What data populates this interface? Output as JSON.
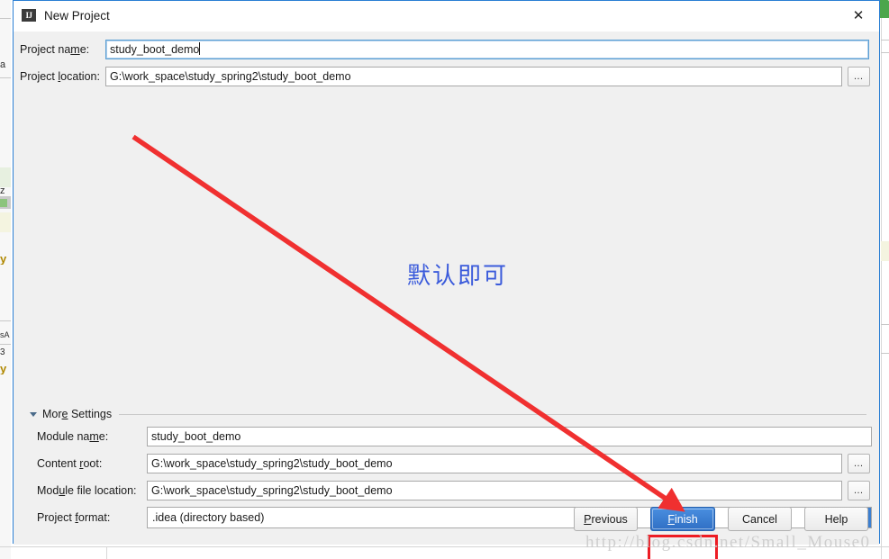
{
  "window": {
    "title": "New Project",
    "icon": "intellij-idea-icon",
    "icon_text": "IJ",
    "close_label": "✕"
  },
  "top_fields": [
    {
      "label_before": "Project na",
      "label_mnemonic": "m",
      "label_after": "e:",
      "value": "study_boot_demo",
      "focused": true,
      "has_browse": false
    },
    {
      "label_before": "Project ",
      "label_mnemonic": "l",
      "label_after": "ocation:",
      "value": "G:\\work_space\\study_spring2\\study_boot_demo",
      "focused": false,
      "has_browse": true
    }
  ],
  "more_settings": {
    "label_before": "Mor",
    "label_mnemonic": "e",
    "label_after": " Settings",
    "expanded": true
  },
  "settings_fields": [
    {
      "label_before": "Module na",
      "label_mnemonic": "m",
      "label_after": "e:",
      "value": "study_boot_demo",
      "has_browse": false
    },
    {
      "label_before": "Content ",
      "label_mnemonic": "r",
      "label_after": "oot:",
      "value": "G:\\work_space\\study_spring2\\study_boot_demo",
      "has_browse": true
    },
    {
      "label_before": "Mod",
      "label_mnemonic": "u",
      "label_after": "le file location:",
      "value": "G:\\work_space\\study_spring2\\study_boot_demo",
      "has_browse": true
    }
  ],
  "project_format": {
    "label_before": "Project ",
    "label_mnemonic": "f",
    "label_after": "ormat:",
    "value": ".idea (directory based)",
    "arrow_icon": "chevron-down-icon"
  },
  "buttons": {
    "previous": {
      "before": "",
      "mnemonic": "P",
      "after": "revious"
    },
    "finish": {
      "before": "",
      "mnemonic": "F",
      "after": "inish",
      "primary": true,
      "highlighted": true
    },
    "cancel": {
      "before": "Cancel",
      "mnemonic": "",
      "after": ""
    },
    "help": {
      "before": "Help",
      "mnemonic": "",
      "after": ""
    }
  },
  "browse_button_label": "…",
  "annotations": {
    "note_text": "默认即可",
    "note_color": "#3b5bdb",
    "arrow_color": "#f03030",
    "highlight_color": "#ed1c24"
  },
  "watermark": {
    "text": "http://blog.csdn.net/Small_Mouse0",
    "color": "#c9c9c9"
  },
  "background": {
    "fragments": [
      "a",
      "z",
      "y",
      "sA",
      "3",
      "y"
    ],
    "green_tab_color": "#4ca64c"
  },
  "colors": {
    "dialog_bg": "#f0f0f0",
    "dialog_border": "#2a7fd4",
    "field_bg": "#ffffff",
    "accent_blue": "#3c7fd0"
  }
}
